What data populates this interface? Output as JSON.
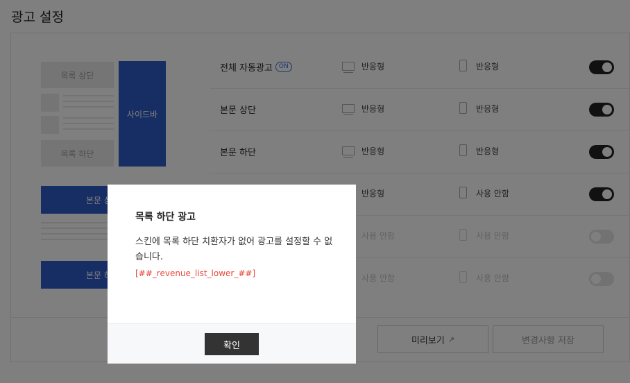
{
  "page": {
    "title": "광고 설정"
  },
  "preview": {
    "list_top": "목록 상단",
    "sidebar": "사이드바",
    "list_bottom": "목록 하단",
    "body_top_partial": "본문 상",
    "body_bottom_partial": "본문 하"
  },
  "rows": [
    {
      "label": "전체 자동광고",
      "badge": "ON",
      "pc": "반응형",
      "mobile": "반응형",
      "enabled": true
    },
    {
      "label": "본문 상단",
      "pc": "반응형",
      "mobile": "반응형",
      "enabled": true
    },
    {
      "label": "본문 하단",
      "pc": "반응형",
      "mobile": "반응형",
      "enabled": true
    },
    {
      "label": "",
      "pc": "반응형",
      "mobile": "사용 안함",
      "enabled": true
    },
    {
      "label": "",
      "pc": "사용 안함",
      "mobile": "사용 안함",
      "enabled": false
    },
    {
      "label": "",
      "pc": "사용 안함",
      "mobile": "사용 안함",
      "enabled": false
    }
  ],
  "footer": {
    "preview_label": "미리보기",
    "save_label": "변경사항 저장"
  },
  "modal": {
    "title": "목록 하단 광고",
    "message": "스킨에 목록 하단 치환자가 없어 광고를 설정할 수 없습니다.",
    "code": "[##_revenue_list_lower_##]",
    "confirm_label": "확인"
  }
}
